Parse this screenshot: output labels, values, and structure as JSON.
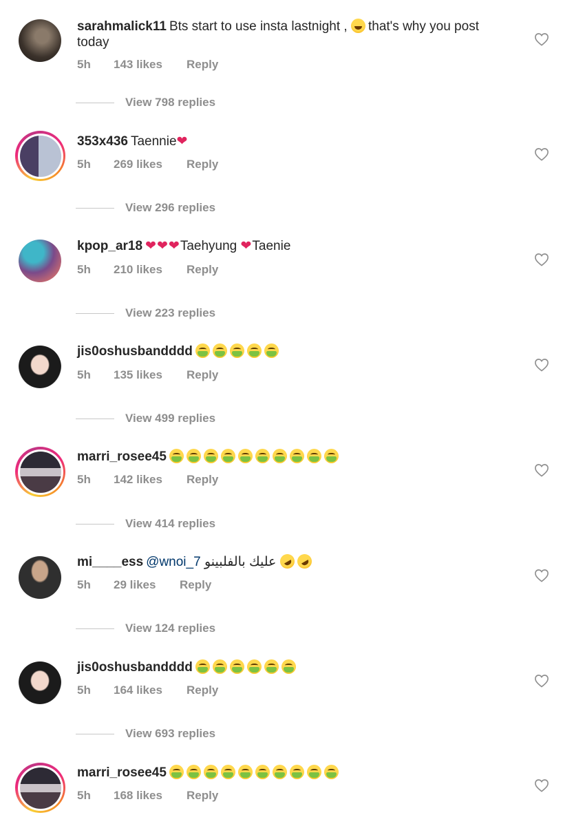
{
  "comments": [
    {
      "username": "sarahmalick11",
      "text1": "Bts start to use insta lastnight ,",
      "text2": "that's why you post",
      "text3": "today",
      "time": "5h",
      "likes": "143 likes",
      "reply": "Reply",
      "view_replies": "View 798 replies"
    },
    {
      "username": "353x436",
      "text": "Taennie",
      "time": "5h",
      "likes": "269 likes",
      "reply": "Reply",
      "view_replies": "View 296 replies"
    },
    {
      "username": "kpop_ar18",
      "text_a": "Taehyung",
      "text_b": "Taenie",
      "time": "5h",
      "likes": "210 likes",
      "reply": "Reply",
      "view_replies": "View 223 replies"
    },
    {
      "username": "jis0oshusbandddd",
      "time": "5h",
      "likes": "135 likes",
      "reply": "Reply",
      "view_replies": "View 499 replies"
    },
    {
      "username": "marri_rosee45",
      "time": "5h",
      "likes": "142 likes",
      "reply": "Reply",
      "view_replies": "View 414 replies"
    },
    {
      "username": "mi____ess",
      "mention": "@wnoi_7",
      "arabic": "عليك بالفلبينو",
      "time": "5h",
      "likes": "29 likes",
      "reply": "Reply",
      "view_replies": "View 124 replies"
    },
    {
      "username": "jis0oshusbandddd",
      "time": "5h",
      "likes": "164 likes",
      "reply": "Reply",
      "view_replies": "View 693 replies"
    },
    {
      "username": "marri_rosee45",
      "time": "5h",
      "likes": "168 likes",
      "reply": "Reply"
    }
  ],
  "icons": {
    "like": "heart-outline-icon"
  },
  "colors": {
    "text": "#262626",
    "meta": "#8e8e8e",
    "mention": "#00376b",
    "heart_emoji": "#e0245e"
  }
}
